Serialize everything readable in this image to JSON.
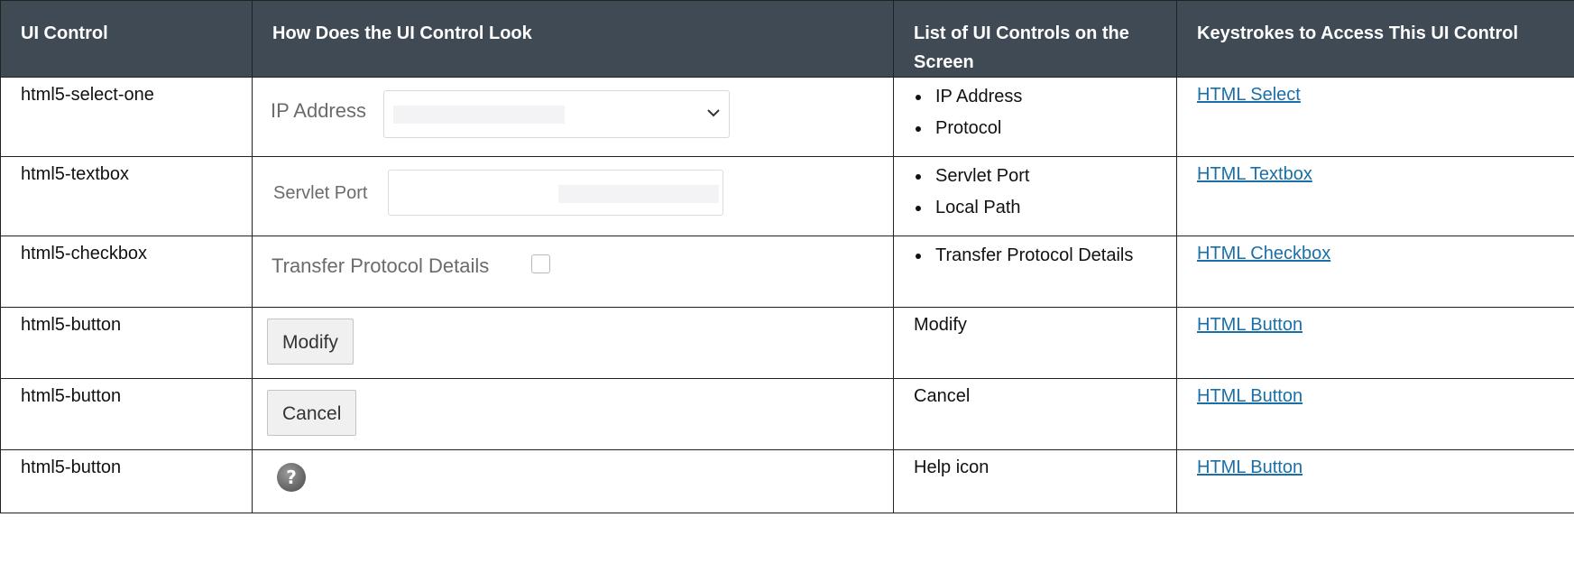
{
  "headers": [
    "UI Control",
    "How Does the UI Control Look",
    "List of UI Controls on the Screen",
    "Keystrokes to Access This UI Control"
  ],
  "rows": [
    {
      "control": "html5-select-one",
      "look_label": "IP Address",
      "items": [
        "IP Address",
        "Protocol"
      ],
      "link": "HTML Select"
    },
    {
      "control": "html5-textbox",
      "look_label": "Servlet Port",
      "items": [
        "Servlet Port",
        "Local Path"
      ],
      "link": "HTML Textbox"
    },
    {
      "control": "html5-checkbox",
      "look_label": "Transfer Protocol Details",
      "items": [
        "Transfer Protocol Details"
      ],
      "link": "HTML Checkbox"
    },
    {
      "control": "html5-button",
      "look_label": "Modify",
      "list_text": "Modify",
      "link": "HTML Button"
    },
    {
      "control": "html5-button",
      "look_label": "Cancel",
      "list_text": "Cancel",
      "link": "HTML Button"
    },
    {
      "control": "html5-button",
      "look_icon": "help-icon",
      "list_text": "Help icon",
      "link": "HTML Button"
    }
  ],
  "colors": {
    "header_bg": "#3f4a55",
    "link": "#1b6fa8"
  }
}
